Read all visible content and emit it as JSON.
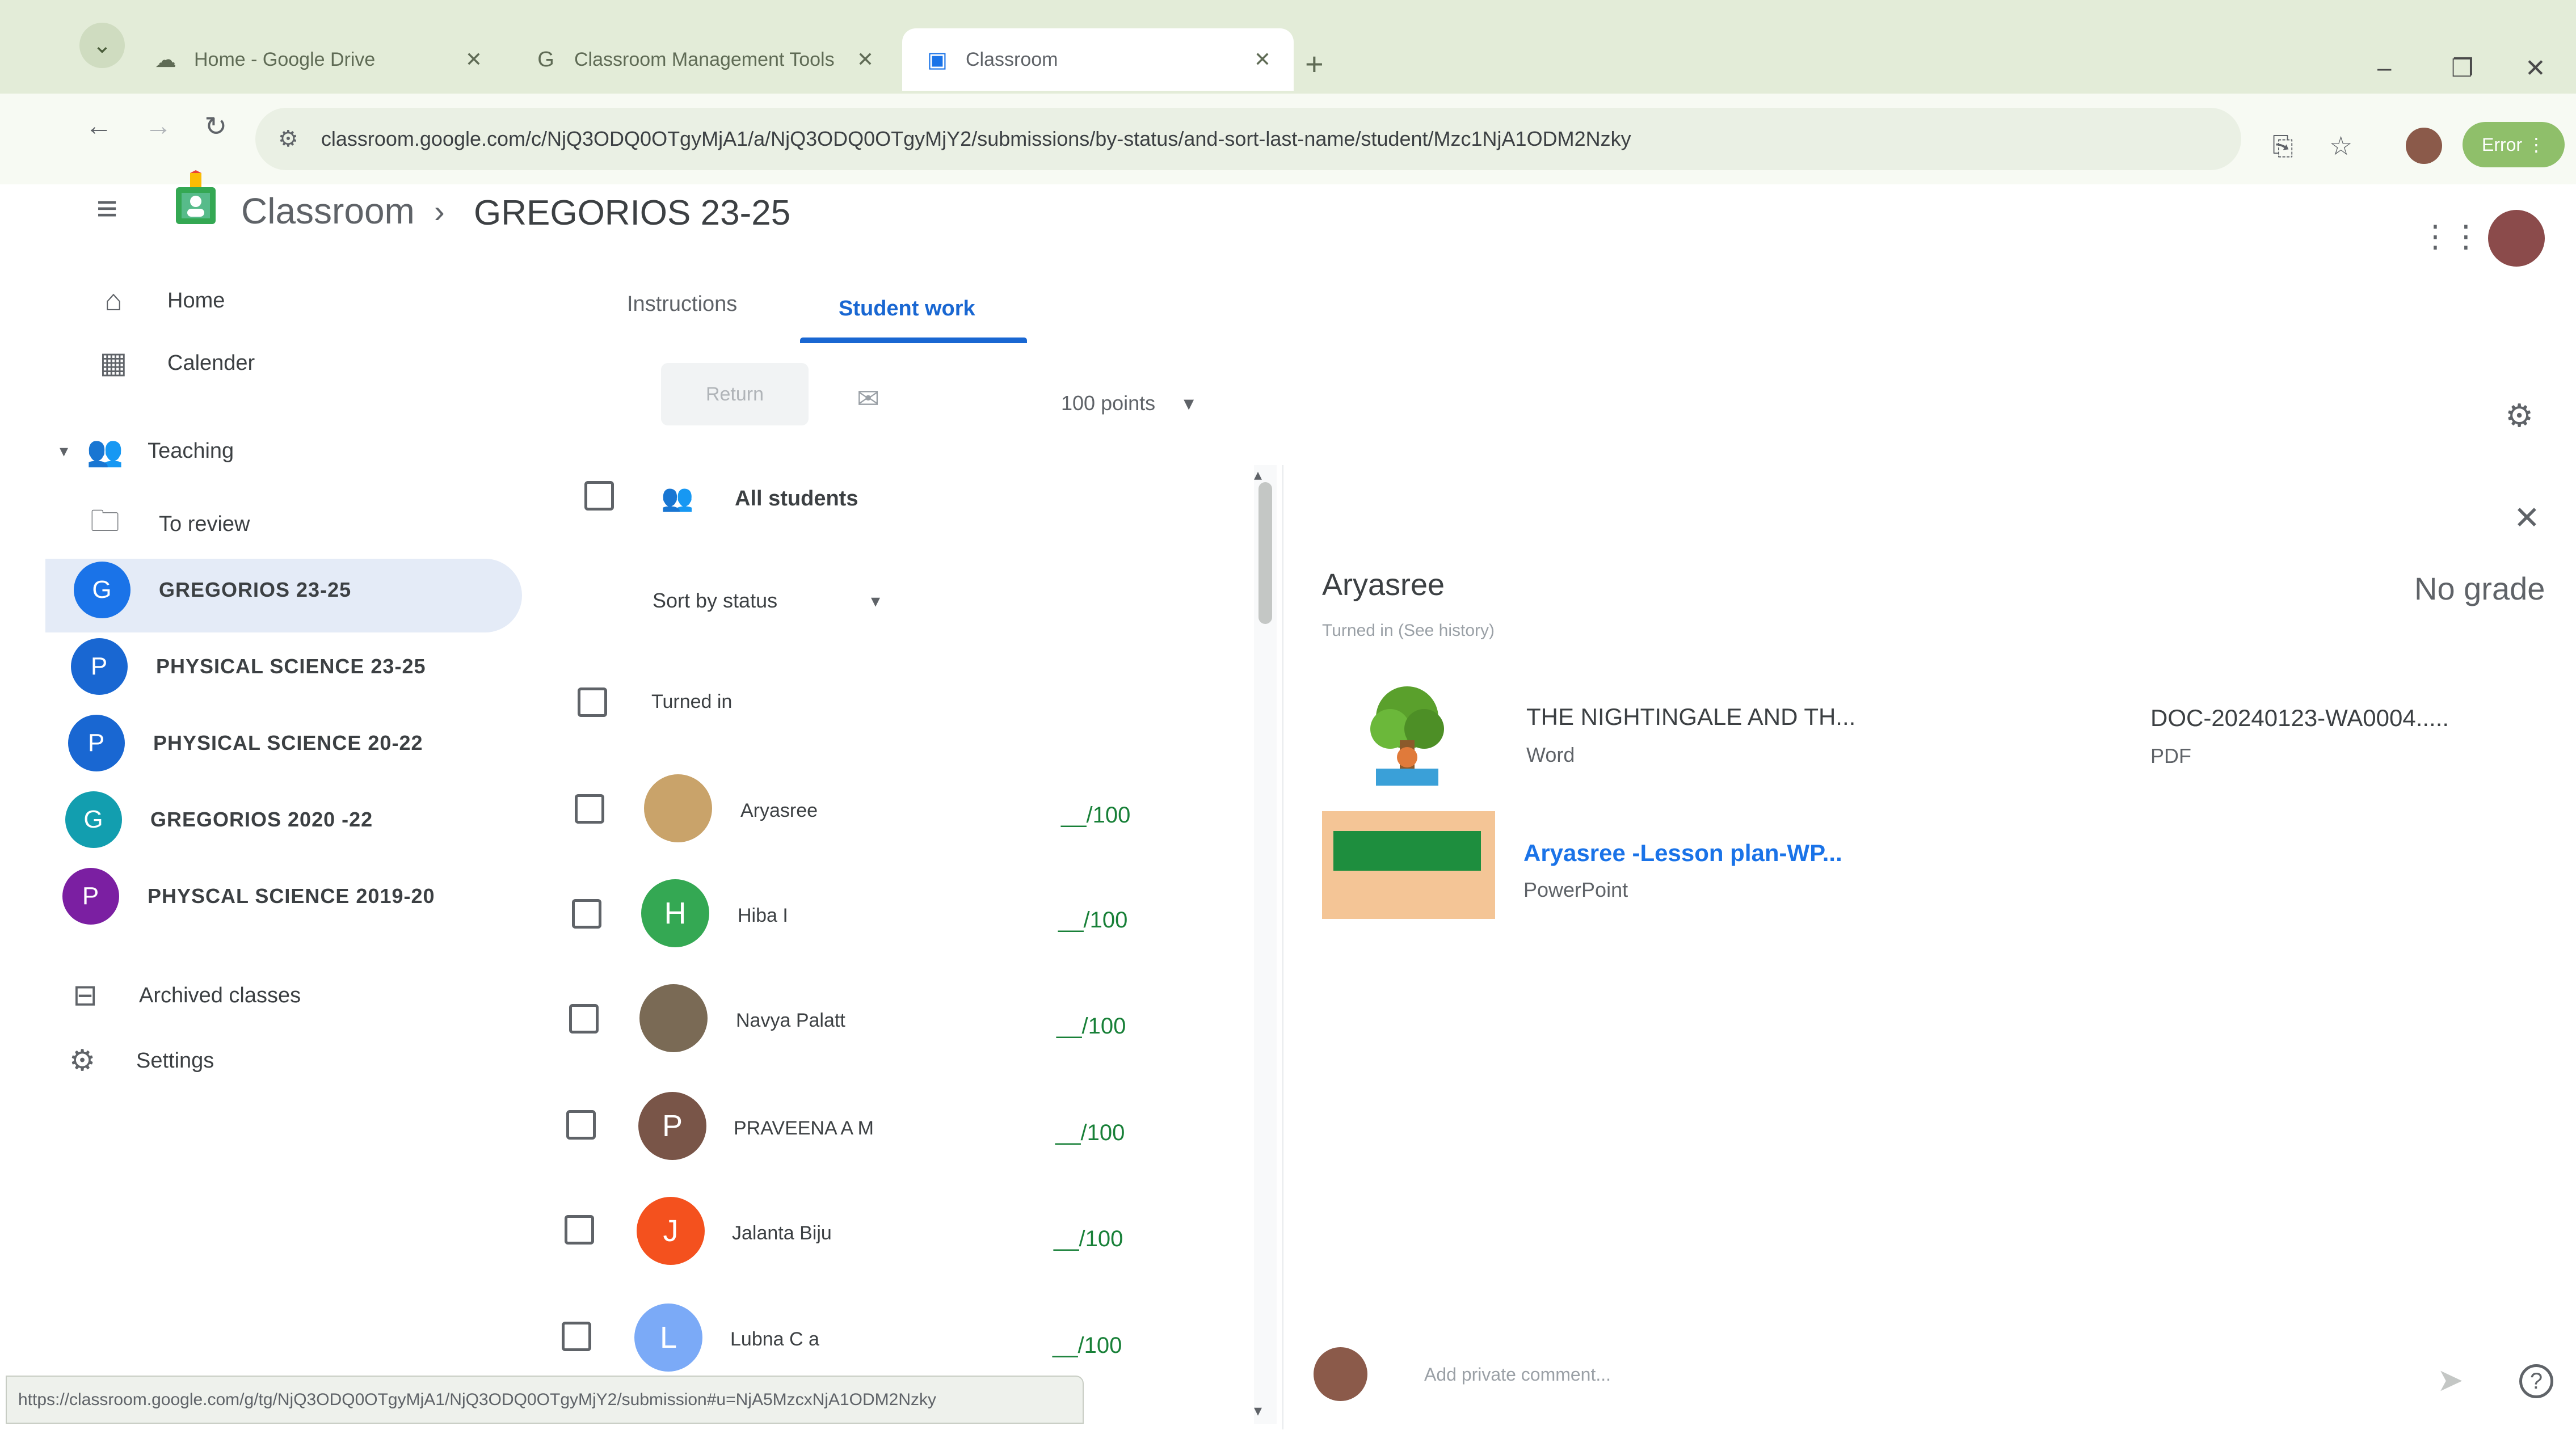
{
  "browser": {
    "tabs": [
      {
        "title": "Home - Google Drive",
        "icon": "drive-icon"
      },
      {
        "title": "Classroom Management Tools",
        "icon": "google-icon"
      },
      {
        "title": "Classroom",
        "icon": "classroom-icon"
      }
    ],
    "url": "classroom.google.com/c/NjQ3ODQ0OTgyMjA1/a/NjQ3ODQ0OTgyMjY2/submissions/by-status/and-sort-last-name/student/Mzc1NjA1ODM2Nzky",
    "error_label": "Error",
    "status_url": "https://classroom.google.com/g/tg/NjQ3ODQ0OTgyMjA1/NjQ3ODQ0OTgyMjY2/submission#u=NjA5MzcxNjA1ODM2Nzky"
  },
  "header": {
    "app_name": "Classroom",
    "class_name": "GREGORIOS 23-25"
  },
  "sidebar": {
    "home": "Home",
    "calendar": "Calender",
    "teaching": "Teaching",
    "to_review": "To review",
    "classes": [
      {
        "initial": "G",
        "name": "GREGORIOS 23-25",
        "color": "#1a73e8"
      },
      {
        "initial": "P",
        "name": "PHYSICAL SCIENCE 23-25",
        "color": "#1967d2"
      },
      {
        "initial": "P",
        "name": "PHYSICAL SCIENCE 20-22",
        "color": "#1967d2"
      },
      {
        "initial": "G",
        "name": "GREGORIOS 2020 -22",
        "color": "#129eaf"
      },
      {
        "initial": "P",
        "name": "PHYSCAL SCIENCE 2019-20",
        "color": "#7b1fa2"
      }
    ],
    "archived": "Archived classes",
    "settings": "Settings"
  },
  "tabs": {
    "instructions": "Instructions",
    "student_work": "Student work"
  },
  "toolbar": {
    "return_label": "Return",
    "points_label": "100 points"
  },
  "roster": {
    "all_students": "All students",
    "sort_label": "Sort by status",
    "section_label": "Turned in",
    "students": [
      {
        "name": "Aryasree",
        "initial": "",
        "color": "#c9a36a",
        "grade": "__/100"
      },
      {
        "name": "Hiba I",
        "initial": "H",
        "color": "#34a853",
        "grade": "__/100"
      },
      {
        "name": "Navya Palatt",
        "initial": "",
        "color": "#7a6a55",
        "grade": "__/100"
      },
      {
        "name": "PRAVEENA A M",
        "initial": "P",
        "color": "#795548",
        "grade": "__/100"
      },
      {
        "name": "Jalanta Biju",
        "initial": "J",
        "color": "#f4511e",
        "grade": "__/100"
      },
      {
        "name": "Lubna C a",
        "initial": "L",
        "color": "#7baaf7",
        "grade": "__/100"
      }
    ]
  },
  "panel": {
    "student_name": "Aryasree",
    "grade": "No grade",
    "status": "Turned in (See history)",
    "attachments": [
      {
        "title": "THE NIGHTINGALE AND TH...",
        "type": "Word"
      },
      {
        "title": "DOC-20240123-WA0004.....",
        "type": "PDF"
      },
      {
        "title": "Aryasree -Lesson plan-WP...",
        "type": "PowerPoint"
      }
    ],
    "comment_placeholder": "Add private comment..."
  }
}
